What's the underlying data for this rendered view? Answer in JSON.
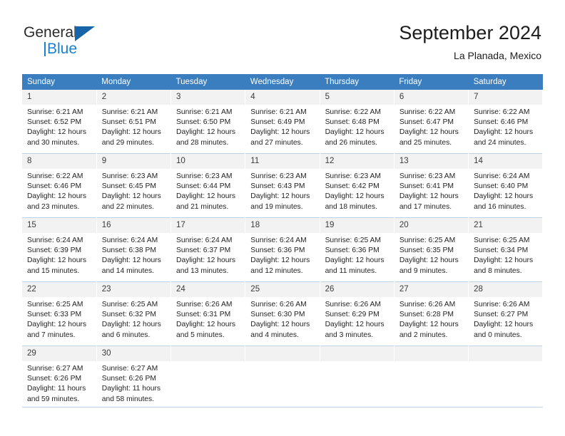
{
  "brand": {
    "name_part1": "General",
    "name_part2": "Blue",
    "icon": "triangle-logo-icon",
    "accent_color": "#1b7fd4"
  },
  "header": {
    "title": "September 2024",
    "subtitle": "La Planada, Mexico"
  },
  "theme": {
    "header_row_bg": "#3a7ebf",
    "daynum_bg": "#f2f2f2",
    "grid_line": "#bcd3e8"
  },
  "weekdays": [
    "Sunday",
    "Monday",
    "Tuesday",
    "Wednesday",
    "Thursday",
    "Friday",
    "Saturday"
  ],
  "weeks": [
    [
      {
        "day": "1",
        "sunrise": "Sunrise: 6:21 AM",
        "sunset": "Sunset: 6:52 PM",
        "daylight1": "Daylight: 12 hours",
        "daylight2": "and 30 minutes."
      },
      {
        "day": "2",
        "sunrise": "Sunrise: 6:21 AM",
        "sunset": "Sunset: 6:51 PM",
        "daylight1": "Daylight: 12 hours",
        "daylight2": "and 29 minutes."
      },
      {
        "day": "3",
        "sunrise": "Sunrise: 6:21 AM",
        "sunset": "Sunset: 6:50 PM",
        "daylight1": "Daylight: 12 hours",
        "daylight2": "and 28 minutes."
      },
      {
        "day": "4",
        "sunrise": "Sunrise: 6:21 AM",
        "sunset": "Sunset: 6:49 PM",
        "daylight1": "Daylight: 12 hours",
        "daylight2": "and 27 minutes."
      },
      {
        "day": "5",
        "sunrise": "Sunrise: 6:22 AM",
        "sunset": "Sunset: 6:48 PM",
        "daylight1": "Daylight: 12 hours",
        "daylight2": "and 26 minutes."
      },
      {
        "day": "6",
        "sunrise": "Sunrise: 6:22 AM",
        "sunset": "Sunset: 6:47 PM",
        "daylight1": "Daylight: 12 hours",
        "daylight2": "and 25 minutes."
      },
      {
        "day": "7",
        "sunrise": "Sunrise: 6:22 AM",
        "sunset": "Sunset: 6:46 PM",
        "daylight1": "Daylight: 12 hours",
        "daylight2": "and 24 minutes."
      }
    ],
    [
      {
        "day": "8",
        "sunrise": "Sunrise: 6:22 AM",
        "sunset": "Sunset: 6:46 PM",
        "daylight1": "Daylight: 12 hours",
        "daylight2": "and 23 minutes."
      },
      {
        "day": "9",
        "sunrise": "Sunrise: 6:23 AM",
        "sunset": "Sunset: 6:45 PM",
        "daylight1": "Daylight: 12 hours",
        "daylight2": "and 22 minutes."
      },
      {
        "day": "10",
        "sunrise": "Sunrise: 6:23 AM",
        "sunset": "Sunset: 6:44 PM",
        "daylight1": "Daylight: 12 hours",
        "daylight2": "and 21 minutes."
      },
      {
        "day": "11",
        "sunrise": "Sunrise: 6:23 AM",
        "sunset": "Sunset: 6:43 PM",
        "daylight1": "Daylight: 12 hours",
        "daylight2": "and 19 minutes."
      },
      {
        "day": "12",
        "sunrise": "Sunrise: 6:23 AM",
        "sunset": "Sunset: 6:42 PM",
        "daylight1": "Daylight: 12 hours",
        "daylight2": "and 18 minutes."
      },
      {
        "day": "13",
        "sunrise": "Sunrise: 6:23 AM",
        "sunset": "Sunset: 6:41 PM",
        "daylight1": "Daylight: 12 hours",
        "daylight2": "and 17 minutes."
      },
      {
        "day": "14",
        "sunrise": "Sunrise: 6:24 AM",
        "sunset": "Sunset: 6:40 PM",
        "daylight1": "Daylight: 12 hours",
        "daylight2": "and 16 minutes."
      }
    ],
    [
      {
        "day": "15",
        "sunrise": "Sunrise: 6:24 AM",
        "sunset": "Sunset: 6:39 PM",
        "daylight1": "Daylight: 12 hours",
        "daylight2": "and 15 minutes."
      },
      {
        "day": "16",
        "sunrise": "Sunrise: 6:24 AM",
        "sunset": "Sunset: 6:38 PM",
        "daylight1": "Daylight: 12 hours",
        "daylight2": "and 14 minutes."
      },
      {
        "day": "17",
        "sunrise": "Sunrise: 6:24 AM",
        "sunset": "Sunset: 6:37 PM",
        "daylight1": "Daylight: 12 hours",
        "daylight2": "and 13 minutes."
      },
      {
        "day": "18",
        "sunrise": "Sunrise: 6:24 AM",
        "sunset": "Sunset: 6:36 PM",
        "daylight1": "Daylight: 12 hours",
        "daylight2": "and 12 minutes."
      },
      {
        "day": "19",
        "sunrise": "Sunrise: 6:25 AM",
        "sunset": "Sunset: 6:36 PM",
        "daylight1": "Daylight: 12 hours",
        "daylight2": "and 11 minutes."
      },
      {
        "day": "20",
        "sunrise": "Sunrise: 6:25 AM",
        "sunset": "Sunset: 6:35 PM",
        "daylight1": "Daylight: 12 hours",
        "daylight2": "and 9 minutes."
      },
      {
        "day": "21",
        "sunrise": "Sunrise: 6:25 AM",
        "sunset": "Sunset: 6:34 PM",
        "daylight1": "Daylight: 12 hours",
        "daylight2": "and 8 minutes."
      }
    ],
    [
      {
        "day": "22",
        "sunrise": "Sunrise: 6:25 AM",
        "sunset": "Sunset: 6:33 PM",
        "daylight1": "Daylight: 12 hours",
        "daylight2": "and 7 minutes."
      },
      {
        "day": "23",
        "sunrise": "Sunrise: 6:25 AM",
        "sunset": "Sunset: 6:32 PM",
        "daylight1": "Daylight: 12 hours",
        "daylight2": "and 6 minutes."
      },
      {
        "day": "24",
        "sunrise": "Sunrise: 6:26 AM",
        "sunset": "Sunset: 6:31 PM",
        "daylight1": "Daylight: 12 hours",
        "daylight2": "and 5 minutes."
      },
      {
        "day": "25",
        "sunrise": "Sunrise: 6:26 AM",
        "sunset": "Sunset: 6:30 PM",
        "daylight1": "Daylight: 12 hours",
        "daylight2": "and 4 minutes."
      },
      {
        "day": "26",
        "sunrise": "Sunrise: 6:26 AM",
        "sunset": "Sunset: 6:29 PM",
        "daylight1": "Daylight: 12 hours",
        "daylight2": "and 3 minutes."
      },
      {
        "day": "27",
        "sunrise": "Sunrise: 6:26 AM",
        "sunset": "Sunset: 6:28 PM",
        "daylight1": "Daylight: 12 hours",
        "daylight2": "and 2 minutes."
      },
      {
        "day": "28",
        "sunrise": "Sunrise: 6:26 AM",
        "sunset": "Sunset: 6:27 PM",
        "daylight1": "Daylight: 12 hours",
        "daylight2": "and 0 minutes."
      }
    ],
    [
      {
        "day": "29",
        "sunrise": "Sunrise: 6:27 AM",
        "sunset": "Sunset: 6:26 PM",
        "daylight1": "Daylight: 11 hours",
        "daylight2": "and 59 minutes."
      },
      {
        "day": "30",
        "sunrise": "Sunrise: 6:27 AM",
        "sunset": "Sunset: 6:26 PM",
        "daylight1": "Daylight: 11 hours",
        "daylight2": "and 58 minutes."
      },
      {
        "day": "",
        "sunrise": "",
        "sunset": "",
        "daylight1": "",
        "daylight2": ""
      },
      {
        "day": "",
        "sunrise": "",
        "sunset": "",
        "daylight1": "",
        "daylight2": ""
      },
      {
        "day": "",
        "sunrise": "",
        "sunset": "",
        "daylight1": "",
        "daylight2": ""
      },
      {
        "day": "",
        "sunrise": "",
        "sunset": "",
        "daylight1": "",
        "daylight2": ""
      },
      {
        "day": "",
        "sunrise": "",
        "sunset": "",
        "daylight1": "",
        "daylight2": ""
      }
    ]
  ]
}
